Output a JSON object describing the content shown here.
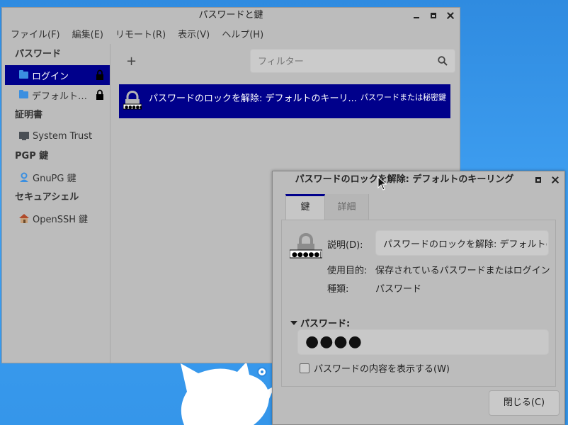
{
  "main_window": {
    "title": "パスワードと鍵",
    "menu": [
      "ファイル(F)",
      "編集(E)",
      "リモート(R)",
      "表示(V)",
      "ヘルプ(H)"
    ],
    "sidebar": {
      "sections": [
        {
          "heading": "パスワード",
          "items": [
            {
              "label": "ログイン",
              "icon": "folder-icon",
              "selected": true,
              "locked": true
            },
            {
              "label": "デフォルト…",
              "icon": "folder-icon",
              "selected": false,
              "locked": true
            }
          ]
        },
        {
          "heading": "証明書",
          "items": [
            {
              "label": "System Trust",
              "icon": "monitor-icon"
            }
          ]
        },
        {
          "heading": "PGP 鍵",
          "items": [
            {
              "label": "GnuPG 鍵",
              "icon": "person-key-icon"
            }
          ]
        },
        {
          "heading": "セキュアシェル",
          "items": [
            {
              "label": "OpenSSH 鍵",
              "icon": "home-icon"
            }
          ]
        }
      ]
    },
    "toolbar": {
      "add_label": "+",
      "filter_placeholder": "フィルター"
    },
    "list": [
      {
        "name": "パスワードのロックを解除: デフォルトのキーリ...",
        "type": "パスワードまたは秘密鍵",
        "selected": true
      }
    ]
  },
  "dialog": {
    "title": "パスワードのロックを解除: デフォルトのキーリング",
    "tabs": [
      "鍵",
      "詳細"
    ],
    "active_tab": "鍵",
    "fields": {
      "description_label": "説明(D):",
      "description_value": "パスワードのロックを解除: デフォルトのキーリング",
      "usage_label": "使用目的:",
      "usage_value": "保存されているパスワードまたはログイン",
      "kind_label": "種類:",
      "kind_value": "パスワード"
    },
    "password_expander": "パスワード:",
    "password_masked": "●●●●",
    "show_password_label": "パスワードの内容を表示する(W)",
    "show_password_checked": false,
    "close_button": "閉じる(C)"
  },
  "colors": {
    "selection": "#00008b",
    "window_bg": "#bcbcbc",
    "desktop": "#3596ea"
  }
}
